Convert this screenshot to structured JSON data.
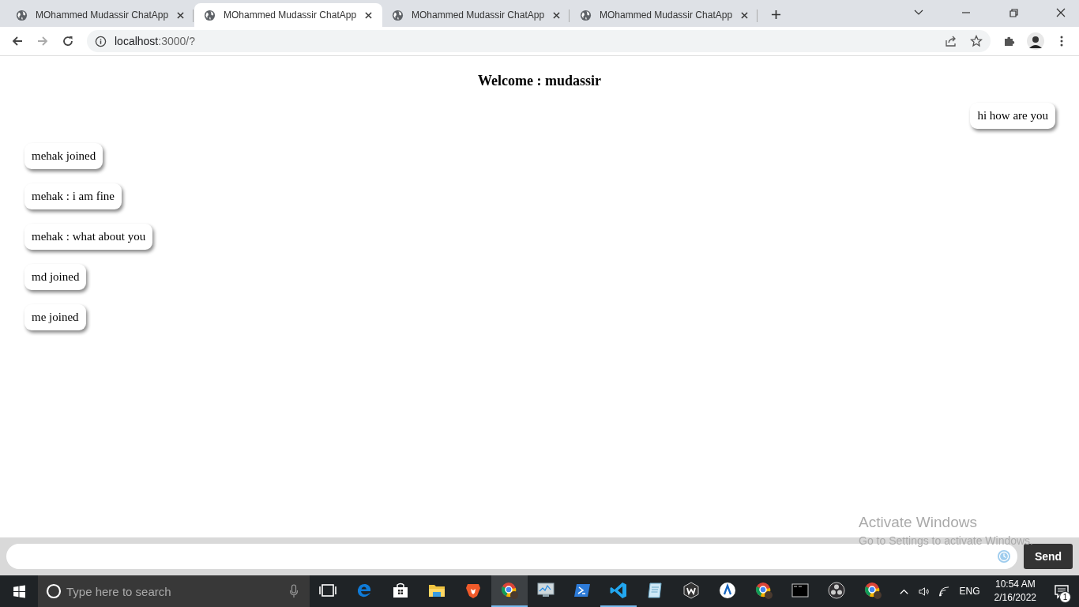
{
  "browser_tabs": [
    {
      "title": "MOhammed Mudassir ChatApp",
      "selected": false
    },
    {
      "title": "MOhammed Mudassir ChatApp",
      "selected": true
    },
    {
      "title": "MOhammed Mudassir ChatApp",
      "selected": false
    },
    {
      "title": "MOhammed Mudassir ChatApp",
      "selected": false
    }
  ],
  "address_bar": {
    "host": "localhost",
    "rest": ":3000/?"
  },
  "page": {
    "heading": "Welcome : mudassir",
    "messages": [
      {
        "kind": "outgoing",
        "text": "hi how are you"
      },
      {
        "kind": "incoming",
        "text": "mehak joined"
      },
      {
        "kind": "incoming",
        "text": "mehak : i am fine"
      },
      {
        "kind": "incoming",
        "text": "mehak : what about you"
      },
      {
        "kind": "incoming",
        "text": "md joined"
      },
      {
        "kind": "incoming",
        "text": "me joined"
      }
    ],
    "send_button": "Send"
  },
  "activation_notice": {
    "title": "Activate Windows",
    "subtitle": "Go to Settings to activate Windows."
  },
  "taskbar": {
    "search_placeholder": "Type here to search",
    "apps": [
      {
        "kind": "taskview",
        "running": false,
        "selected": false
      },
      {
        "kind": "edge",
        "running": false,
        "selected": false
      },
      {
        "kind": "store",
        "running": false,
        "selected": false
      },
      {
        "kind": "folder",
        "running": false,
        "selected": false
      },
      {
        "kind": "brave",
        "running": false,
        "selected": false
      },
      {
        "kind": "chrome",
        "running": true,
        "selected": true
      },
      {
        "kind": "monitor",
        "running": false,
        "selected": false
      },
      {
        "kind": "powershell",
        "running": false,
        "selected": false
      },
      {
        "kind": "vscode",
        "running": true,
        "selected": false
      },
      {
        "kind": "notepad",
        "running": false,
        "selected": false
      },
      {
        "kind": "wbadge",
        "running": false,
        "selected": false
      },
      {
        "kind": "acircle",
        "running": false,
        "selected": false
      },
      {
        "kind": "chrome",
        "running": false,
        "selected": false
      },
      {
        "kind": "terminal",
        "running": false,
        "selected": false
      },
      {
        "kind": "obs",
        "running": false,
        "selected": false
      },
      {
        "kind": "chrome",
        "running": false,
        "selected": false
      }
    ],
    "language": "ENG",
    "time": "10:54 AM",
    "date": "2/16/2022",
    "notifications": "1"
  }
}
